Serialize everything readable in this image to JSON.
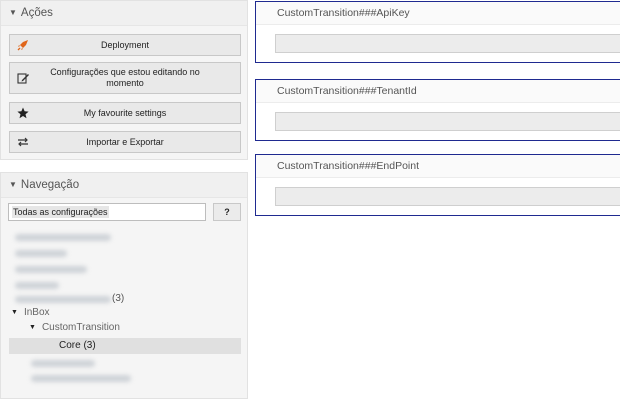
{
  "sidebar": {
    "actions": {
      "title": "Ações",
      "buttons": [
        {
          "label": "Deployment",
          "icon": "rocket-icon"
        },
        {
          "label": "Configurações que estou editando no momento",
          "icon": "edit-icon"
        },
        {
          "label": "My favourite settings",
          "icon": "star-icon"
        },
        {
          "label": "Importar e Exportar",
          "icon": "exchange-icon"
        }
      ]
    },
    "navigation": {
      "title": "Navegação",
      "filter_value": "Todas as configurações",
      "help_label": "?",
      "tree": {
        "inbox": "InBox",
        "custom_transition": "CustomTransition",
        "core_selected": "Core (3)",
        "partial_count": "(3)"
      }
    }
  },
  "settings": [
    {
      "name": "CustomTransition###ApiKey",
      "value": ""
    },
    {
      "name": "CustomTransition###TenantId",
      "value": ""
    },
    {
      "name": "CustomTransition###EndPoint",
      "value": ""
    }
  ],
  "colors": {
    "accent_rocket": "#e0661b",
    "setting_border": "#1f2a90"
  }
}
